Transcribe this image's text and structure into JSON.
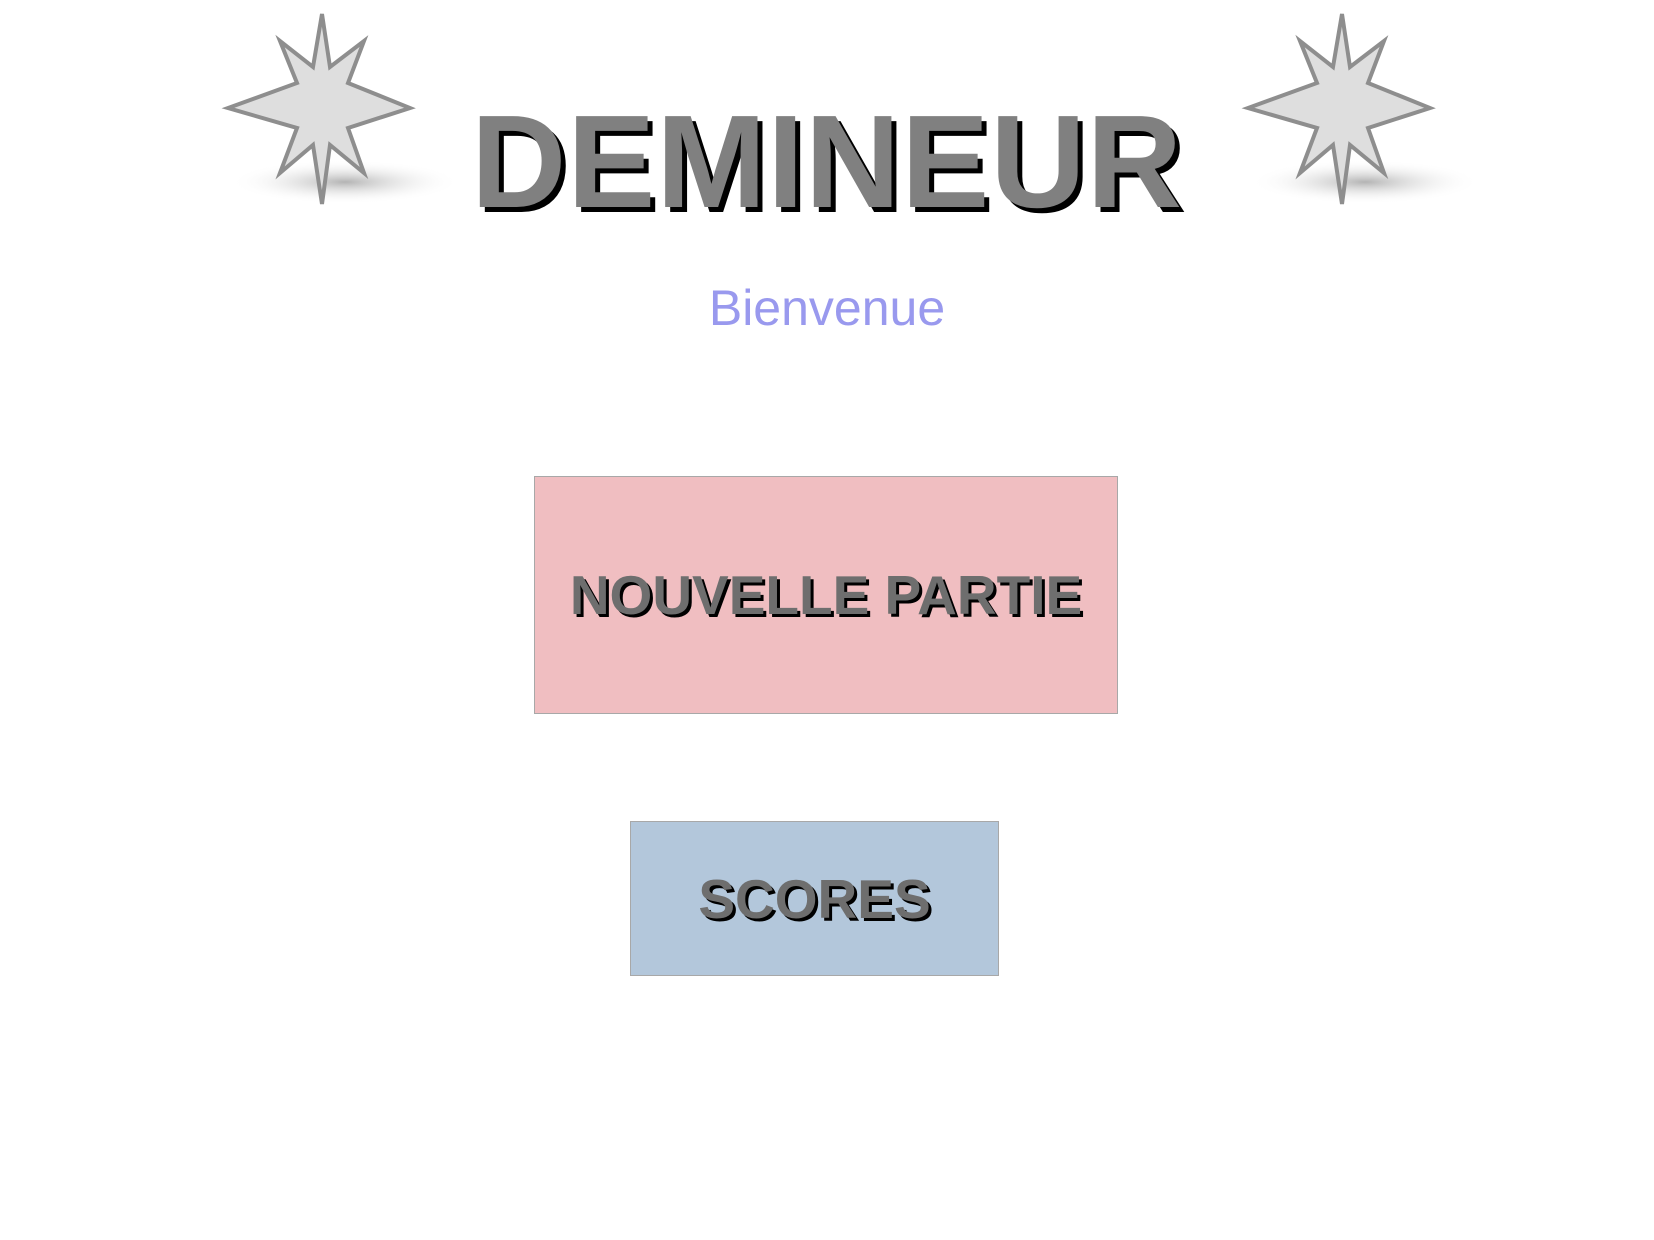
{
  "header": {
    "title": "DEMINEUR",
    "decorations": [
      "star-icon",
      "star-icon"
    ]
  },
  "welcome": {
    "text": "Bienvenue"
  },
  "menu": {
    "new_game_label": "NOUVELLE PARTIE",
    "scores_label": "SCORES"
  },
  "colors": {
    "title_text": "#808080",
    "welcome_text": "#9999ee",
    "new_game_bg": "#f0bec1",
    "scores_bg": "#b3c7db",
    "star_fill": "#dedede",
    "star_stroke": "#8e8e8e"
  }
}
